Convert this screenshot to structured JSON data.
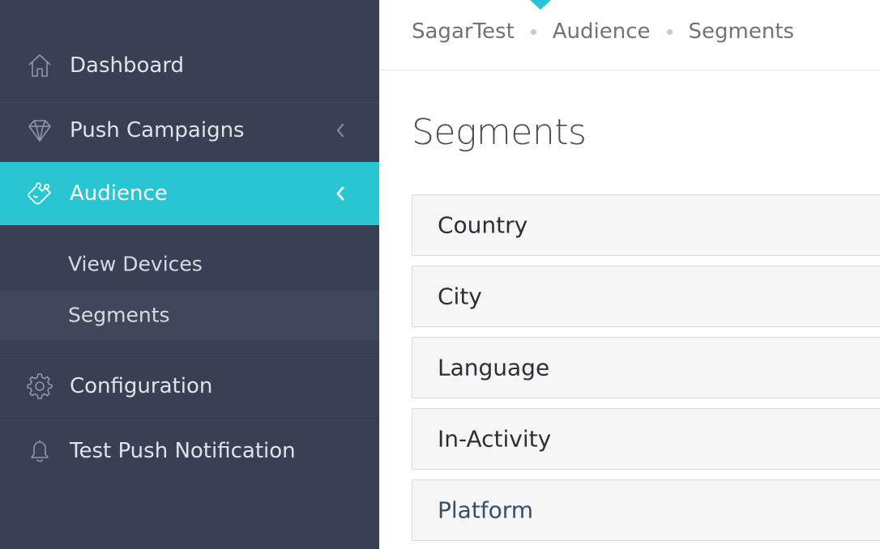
{
  "sidebar": {
    "items": [
      {
        "label": "Dashboard",
        "icon": "home-icon"
      },
      {
        "label": "Push Campaigns",
        "icon": "diamond-icon"
      },
      {
        "label": "Audience",
        "icon": "puzzle-icon"
      },
      {
        "label": "Configuration",
        "icon": "gear-icon"
      },
      {
        "label": "Test Push Notification",
        "icon": "bell-icon"
      }
    ],
    "sub_items": [
      {
        "label": "View Devices"
      },
      {
        "label": "Segments"
      }
    ],
    "active_item": "Audience",
    "selected_sub_item": "Segments",
    "colors": {
      "background": "#374153",
      "active": "#28c5d3",
      "sub_selected": "#3e4859"
    }
  },
  "breadcrumb": [
    "SagarTest",
    "Audience",
    "Segments"
  ],
  "page": {
    "title": "Segments",
    "panels": [
      {
        "label": "Country"
      },
      {
        "label": "City"
      },
      {
        "label": "Language"
      },
      {
        "label": "In-Activity"
      },
      {
        "label": "Platform"
      }
    ]
  }
}
